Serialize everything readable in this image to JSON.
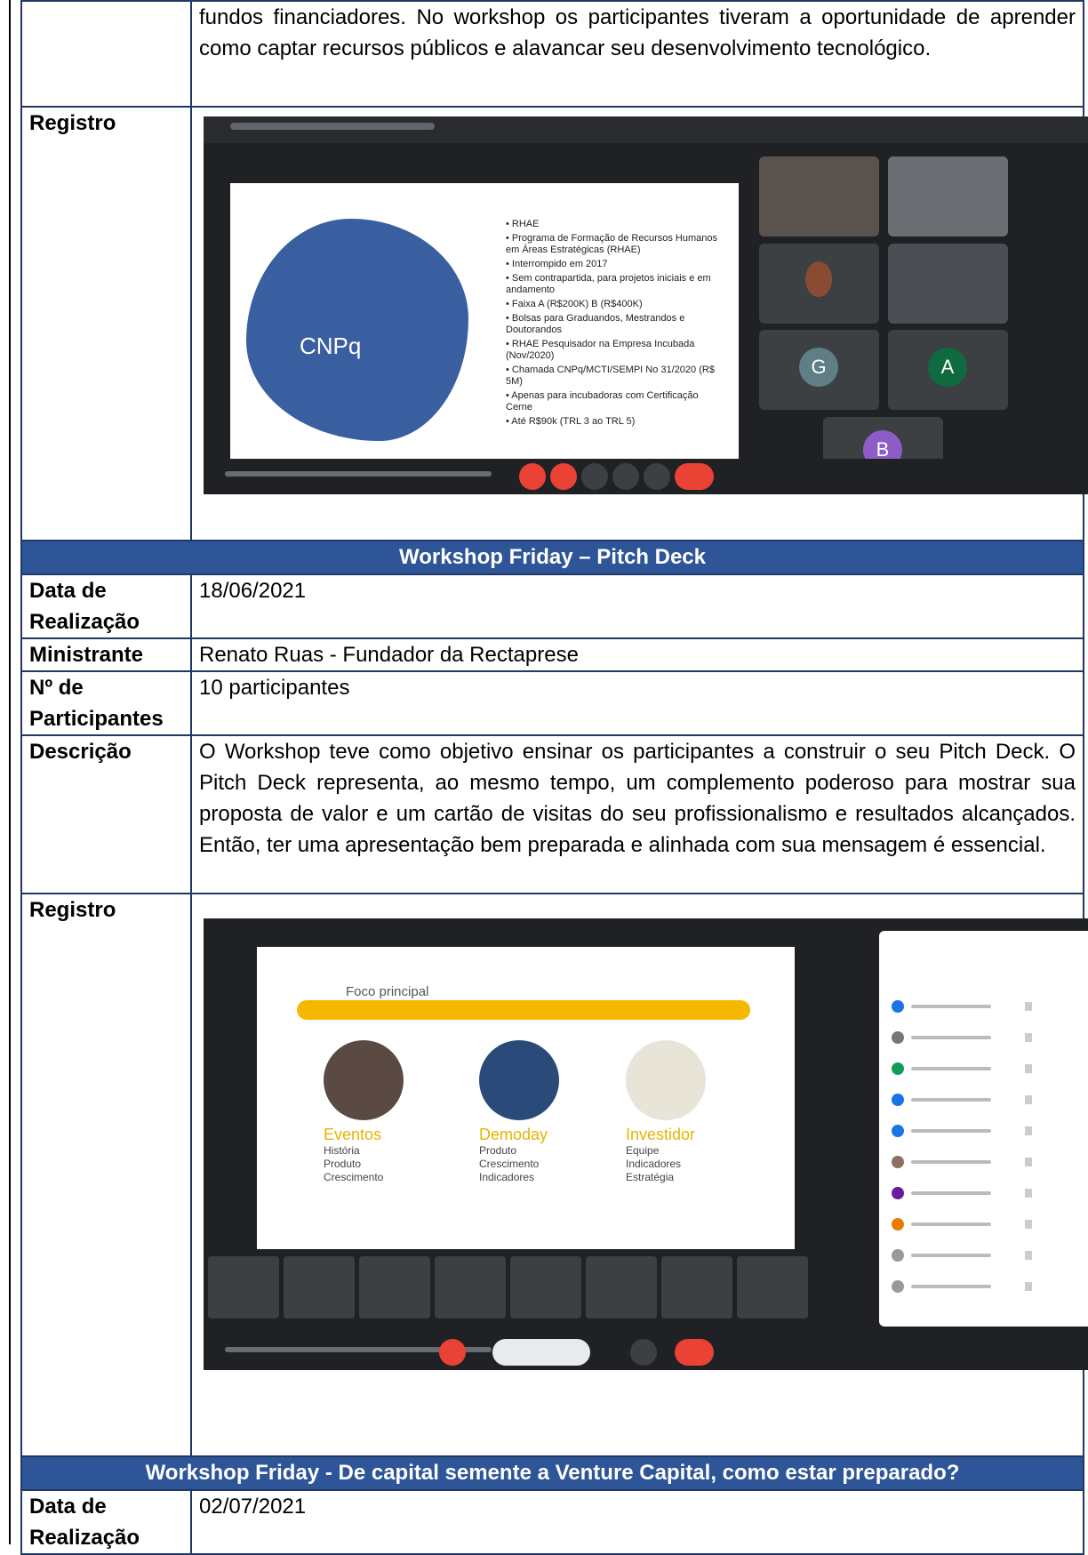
{
  "top_cont": {
    "text": "fundos financiadores. No workshop os participantes tiveram a oportunidade de aprender como captar recursos públicos e alavancar seu desenvolvimento tecnológico."
  },
  "registro1": {
    "label": "Registro",
    "meet": {
      "slide_title": "CNPq",
      "bullets": [
        "• RHAE",
        "• Programa de Formação de Recursos Humanos em Áreas Estratégicas (RHAE)",
        "• Interrompido em 2017",
        "• Sem contrapartida, para projetos iniciais e em andamento",
        "• Faixa A (R$200K) B (R$400K)",
        "• Bolsas para Graduandos, Mestrandos e Doutorandos",
        "• RHAE Pesquisador na Empresa Incubada (Nov/2020)",
        "• Chamada CNPq/MCTI/SEMPI No 31/2020 (R$ 5M)",
        "• Apenas para incubadoras com Certificação Cerne",
        "• Até R$90k (TRL 3 ao TRL 5)"
      ],
      "avatars": [
        "G",
        "A",
        "B"
      ]
    }
  },
  "pitch": {
    "header": "Workshop Friday – Pitch Deck",
    "rows": [
      {
        "label": "Data de Realização",
        "value": "18/06/2021"
      },
      {
        "label": "Ministrante",
        "value": "Renato Ruas - Fundador da Rectaprese"
      },
      {
        "label": "Nº de Participantes",
        "value": "10 participantes"
      }
    ],
    "descricao_label": "Descrição",
    "descricao": "O Workshop teve como objetivo ensinar os participantes a construir o seu Pitch Deck. O Pitch Deck representa, ao mesmo tempo, um complemento poderoso para mostrar sua proposta de valor e um cartão de visitas do seu profissionalismo e resultados alcançados. Então, ter uma apresentação bem preparada e alinhada com sua mensagem é essencial.",
    "registro_label": "Registro",
    "slide": {
      "foco": "Foco principal",
      "cols": [
        {
          "title": "Eventos",
          "items": [
            "História",
            "Produto",
            "Crescimento"
          ]
        },
        {
          "title": "Demoday",
          "items": [
            "Produto",
            "Crescimento",
            "Indicadores"
          ]
        },
        {
          "title": "Investidor",
          "items": [
            "Equipe",
            "Indicadores",
            "Estratégia"
          ]
        }
      ]
    }
  },
  "seed": {
    "header": "Workshop Friday - De capital semente a Venture Capital, como estar preparado?",
    "label": "Data de Realização",
    "value": "02/07/2021"
  },
  "colors": {
    "header_bg": "#2e5597",
    "border": "#1f3864"
  }
}
